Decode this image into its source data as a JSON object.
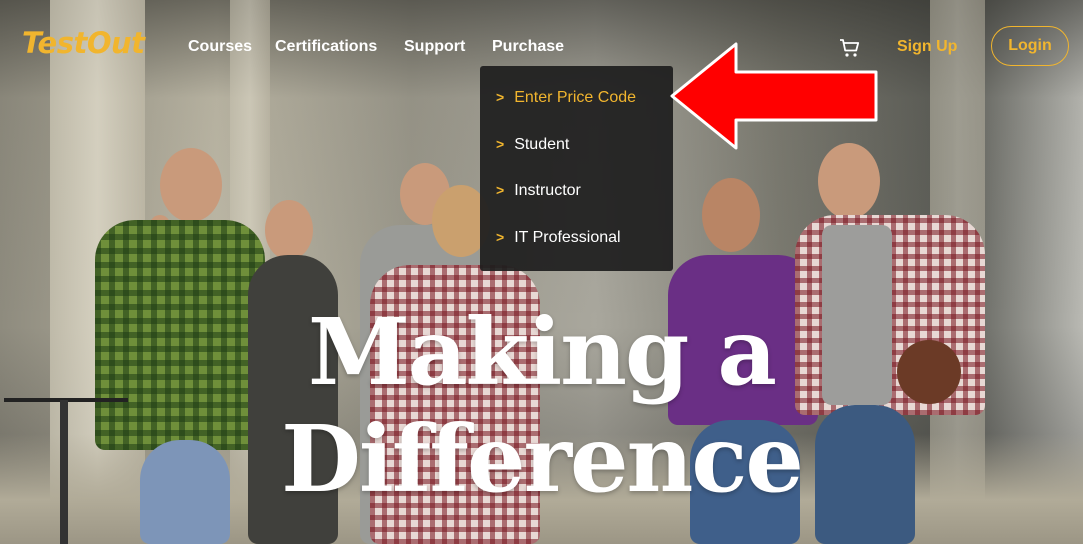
{
  "brand": {
    "logo_text": "TestOut",
    "accent_color": "#f1b52e"
  },
  "nav": {
    "links": [
      "Courses",
      "Certifications",
      "Support",
      "Purchase"
    ],
    "cart_icon": "shopping-cart-icon",
    "signup_label": "Sign Up",
    "login_label": "Login"
  },
  "purchase_menu": {
    "items": [
      {
        "label": "Enter Price Code",
        "active": true
      },
      {
        "label": "Student",
        "active": false
      },
      {
        "label": "Instructor",
        "active": false
      },
      {
        "label": "IT Professional",
        "active": false
      }
    ]
  },
  "annotation": {
    "arrow_color": "#ff0000",
    "arrow_icon": "red-arrow-pointer-icon"
  },
  "hero": {
    "headline_line1": "Making a",
    "headline_line2": "Difference"
  }
}
